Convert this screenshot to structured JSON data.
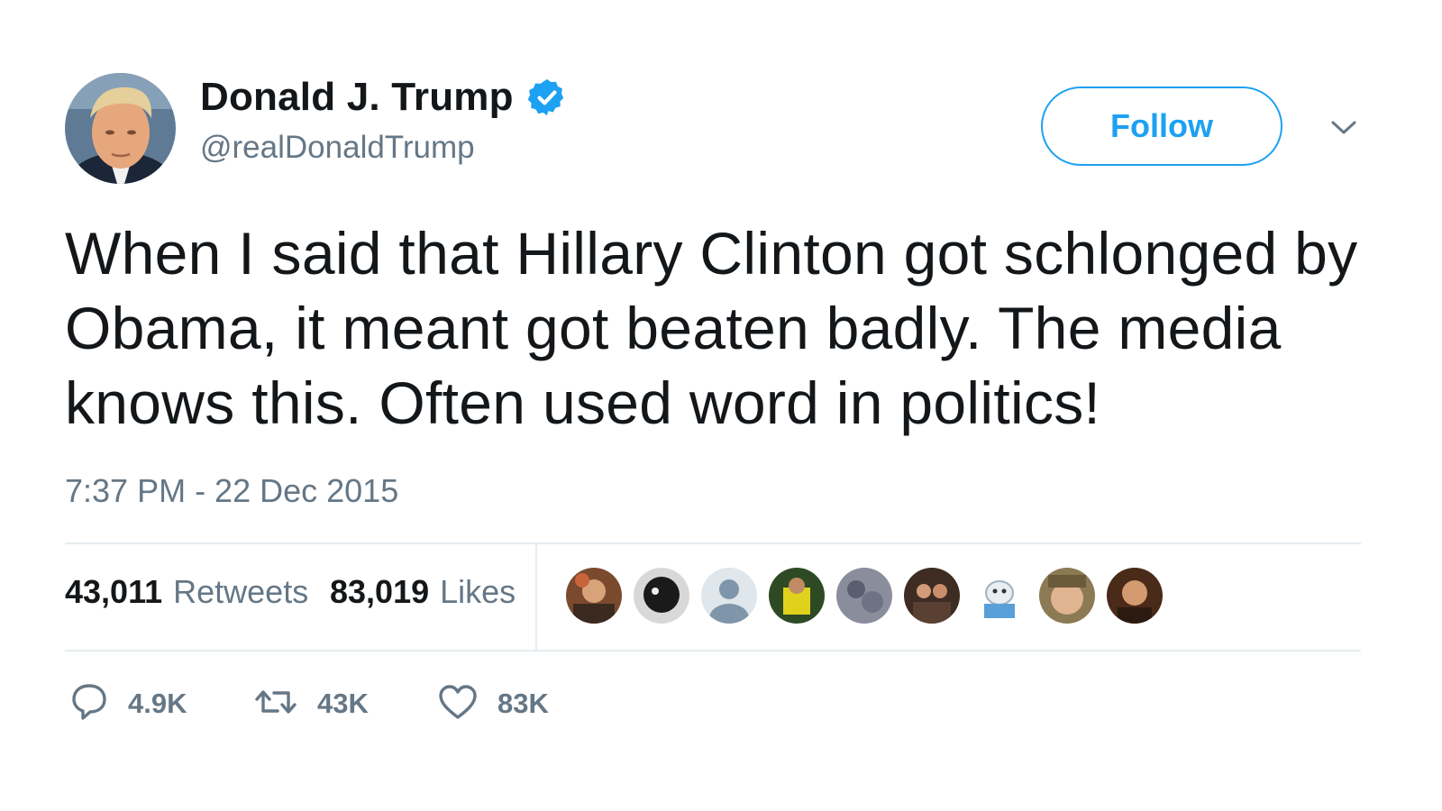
{
  "user": {
    "display_name": "Donald J. Trump",
    "handle": "@realDonaldTrump",
    "verified": true
  },
  "header": {
    "follow_label": "Follow"
  },
  "tweet": {
    "text": "When I said that Hillary Clinton got schlonged by Obama, it meant got beaten badly. The media knows this. Often used word in politics!",
    "timestamp": "7:37 PM - 22 Dec 2015"
  },
  "stats": {
    "retweets_count": "43,011",
    "retweets_label": "Retweets",
    "likes_count": "83,019",
    "likes_label": "Likes",
    "liker_avatars": 9
  },
  "actions": {
    "reply_count": "4.9K",
    "retweet_count": "43K",
    "like_count": "83K"
  },
  "colors": {
    "accent": "#1da1f2",
    "text_primary": "#14171a",
    "text_secondary": "#657786",
    "divider": "#e6ecf0"
  },
  "icons": {
    "verified": "verified-badge-icon",
    "chevron": "chevron-down-icon",
    "reply": "reply-icon",
    "retweet": "retweet-icon",
    "like": "heart-icon"
  }
}
